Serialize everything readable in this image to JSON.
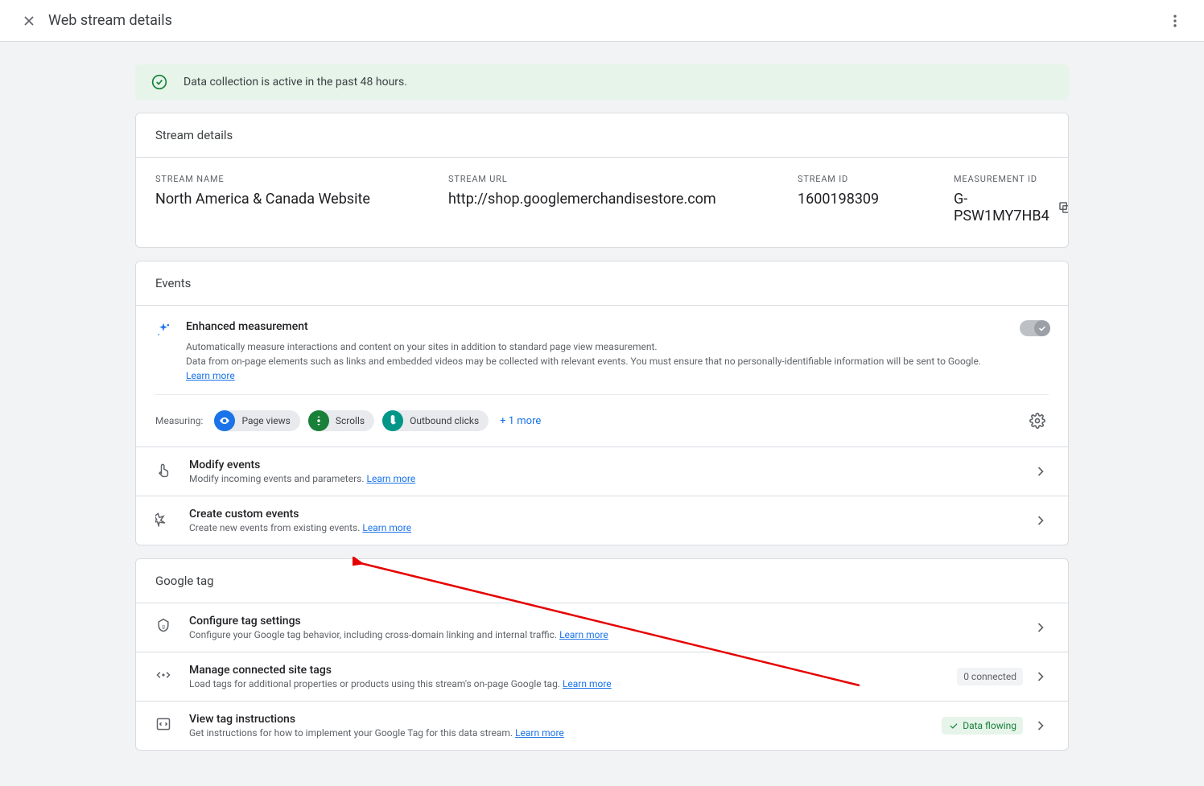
{
  "header": {
    "title": "Web stream details"
  },
  "banner": {
    "text": "Data collection is active in the past 48 hours."
  },
  "stream_details": {
    "section_title": "Stream details",
    "name_label": "STREAM NAME",
    "name_value": "North America & Canada Website",
    "url_label": "STREAM URL",
    "url_value": "http://shop.googlemerchandisestore.com",
    "id_label": "STREAM ID",
    "id_value": "1600198309",
    "mid_label": "MEASUREMENT ID",
    "mid_value": "G-PSW1MY7HB4"
  },
  "events": {
    "section_title": "Events",
    "enhanced": {
      "title": "Enhanced measurement",
      "desc1": "Automatically measure interactions and content on your sites in addition to standard page view measurement.",
      "desc2": "Data from on-page elements such as links and embedded videos may be collected with relevant events. You must ensure that no personally-identifiable information will be sent to Google. ",
      "learn_more": "Learn more",
      "measuring_label": "Measuring:",
      "chips": {
        "page_views": "Page views",
        "scrolls": "Scrolls",
        "outbound": "Outbound clicks"
      },
      "more": "+ 1 more"
    },
    "modify": {
      "title": "Modify events",
      "sub": "Modify incoming events and parameters. ",
      "learn_more": "Learn more"
    },
    "custom": {
      "title": "Create custom events",
      "sub": "Create new events from existing events. ",
      "learn_more": "Learn more"
    }
  },
  "google_tag": {
    "section_title": "Google tag",
    "configure": {
      "title": "Configure tag settings",
      "sub": "Configure your Google tag behavior, including cross-domain linking and internal traffic. ",
      "learn_more": "Learn more"
    },
    "manage": {
      "title": "Manage connected site tags",
      "sub": "Load tags for additional properties or products using this stream's on-page Google tag. ",
      "learn_more": "Learn more",
      "badge": "0 connected"
    },
    "view": {
      "title": "View tag instructions",
      "sub": "Get instructions for how to implement your Google Tag for this data stream. ",
      "learn_more": "Learn more",
      "badge": "Data flowing"
    }
  }
}
